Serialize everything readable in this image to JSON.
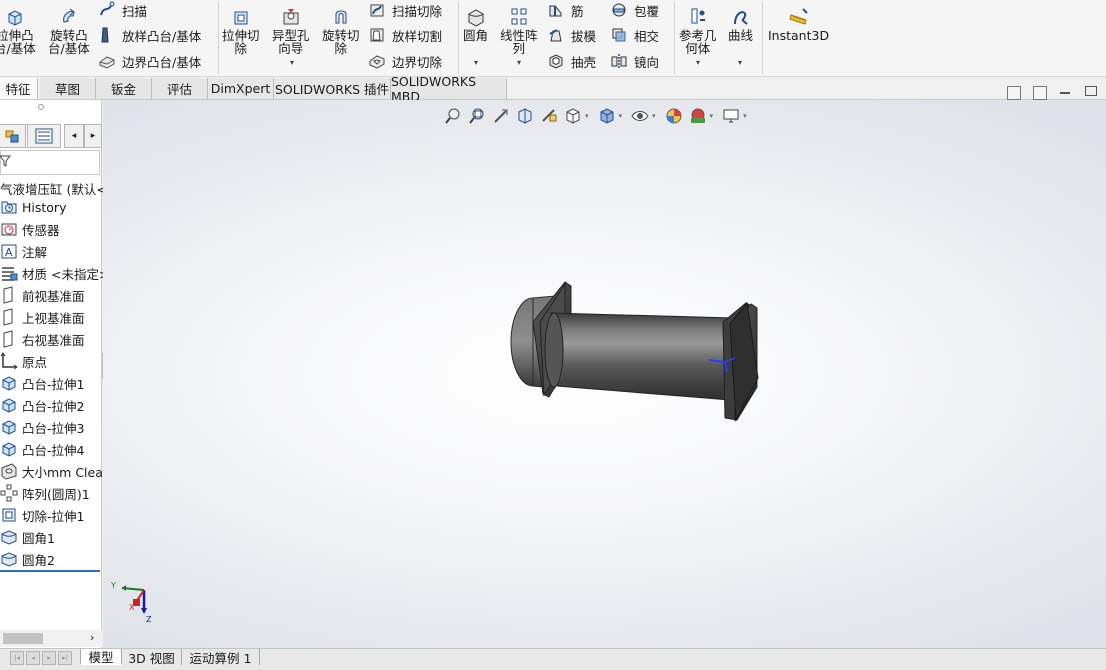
{
  "ribbon": {
    "extrude_boss": "拉伸凸\n台/基体",
    "revolve_boss": "旋转凸\n台/基体",
    "sweep": "扫描",
    "loft_boss": "放样凸台/基体",
    "boundary_boss": "边界凸台/基体",
    "extrude_cut": "拉伸切\n除",
    "hole_wizard": "异型孔\n向导",
    "revolve_cut": "旋转切\n除",
    "swept_cut": "扫描切除",
    "lofted_cut": "放样切割",
    "boundary_cut": "边界切除",
    "fillet": "圆角",
    "linear_pattern": "线性阵\n列",
    "rib": "筋",
    "draft": "拔模",
    "shell": "抽壳",
    "wrap": "包覆",
    "intersect": "相交",
    "mirror": "镜向",
    "reference_geometry": "参考几\n何体",
    "curves": "曲线",
    "instant3d": "Instant3D"
  },
  "cm_tabs": [
    "特征",
    "草图",
    "钣金",
    "评估",
    "DimXpert",
    "SOLIDWORKS 插件",
    "SOLIDWORKS MBD"
  ],
  "feature_manager": {
    "root": "气液增压缸 (默认<",
    "items": [
      {
        "label": "History",
        "icon": "history-icon"
      },
      {
        "label": "传感器",
        "icon": "sensor-icon"
      },
      {
        "label": "注解",
        "icon": "annotation-icon"
      },
      {
        "label": "材质 <未指定>",
        "icon": "material-icon"
      },
      {
        "label": "前视基准面",
        "icon": "plane-icon"
      },
      {
        "label": "上视基准面",
        "icon": "plane-icon"
      },
      {
        "label": "右视基准面",
        "icon": "plane-icon"
      },
      {
        "label": "原点",
        "icon": "origin-icon"
      },
      {
        "label": "凸台-拉伸1",
        "icon": "boss-extrude-icon"
      },
      {
        "label": "凸台-拉伸2",
        "icon": "boss-extrude-icon"
      },
      {
        "label": "凸台-拉伸3",
        "icon": "boss-extrude-icon"
      },
      {
        "label": "凸台-拉伸4",
        "icon": "boss-extrude-icon"
      },
      {
        "label": "大小mm Clear",
        "icon": "hole-wizard-icon"
      },
      {
        "label": "阵列(圆周)1",
        "icon": "circular-pattern-icon"
      },
      {
        "label": "切除-拉伸1",
        "icon": "cut-extrude-icon"
      },
      {
        "label": "圆角1",
        "icon": "fillet-icon"
      },
      {
        "label": "圆角2",
        "icon": "fillet-icon"
      }
    ]
  },
  "triad": {
    "x": "X",
    "y": "Y",
    "z": "Z"
  },
  "bottom_tabs": [
    "模型",
    "3D 视图",
    "运动算例 1"
  ],
  "colors": {
    "accent": "#2d6bc3",
    "part": "#4a4a4a"
  }
}
